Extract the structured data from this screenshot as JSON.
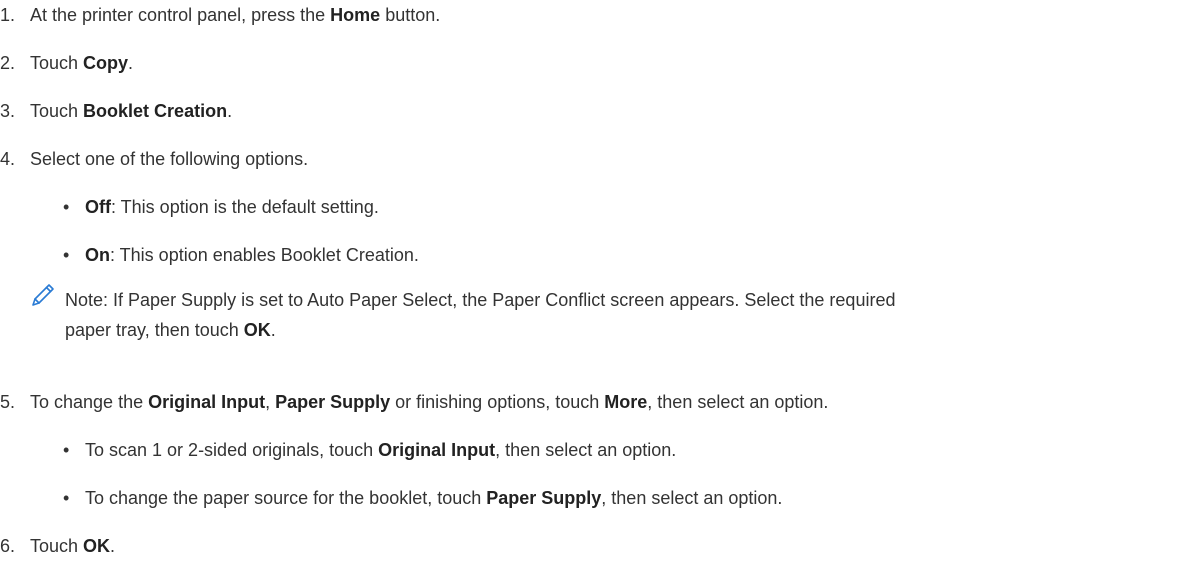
{
  "steps": [
    {
      "num": "1.",
      "pre": "At the printer control panel, press the ",
      "bold": "Home",
      "post": " button."
    },
    {
      "num": "2.",
      "pre": "Touch ",
      "bold": "Copy",
      "post": "."
    },
    {
      "num": "3.",
      "pre": "Touch ",
      "bold": "Booklet Creation",
      "post": "."
    },
    {
      "num": "4.",
      "text": "Select one of the following options."
    },
    {
      "num": "5.",
      "pre": "To change the ",
      "bold1": "Original Input",
      "mid1": ", ",
      "bold2": "Paper Supply",
      "mid2": " or finishing options, touch ",
      "bold3": "More",
      "post": ", then select an option."
    },
    {
      "num": "6.",
      "pre": "Touch ",
      "bold": "OK",
      "post": "."
    }
  ],
  "step4_options": [
    {
      "bold": "Off",
      "post": ": This option is the default setting."
    },
    {
      "bold": "On",
      "post": ": This option enables Booklet Creation."
    }
  ],
  "note": {
    "icon": "pencil-icon",
    "line1": "Note: If Paper Supply is set to Auto Paper Select, the Paper Conflict screen appears. Select the required",
    "line2_pre": "paper tray, then touch ",
    "line2_bold": "OK",
    "line2_post": "."
  },
  "step5_options": [
    {
      "pre": "To scan 1 or 2-sided originals, touch ",
      "bold": "Original Input",
      "post": ", then select an option."
    },
    {
      "pre": "To change the paper source for the booklet, touch ",
      "bold": "Paper Supply",
      "post": ", then select an option."
    }
  ],
  "bullet_glyph": "•",
  "colors": {
    "text": "#333333",
    "icon": "#2a7bd4"
  }
}
